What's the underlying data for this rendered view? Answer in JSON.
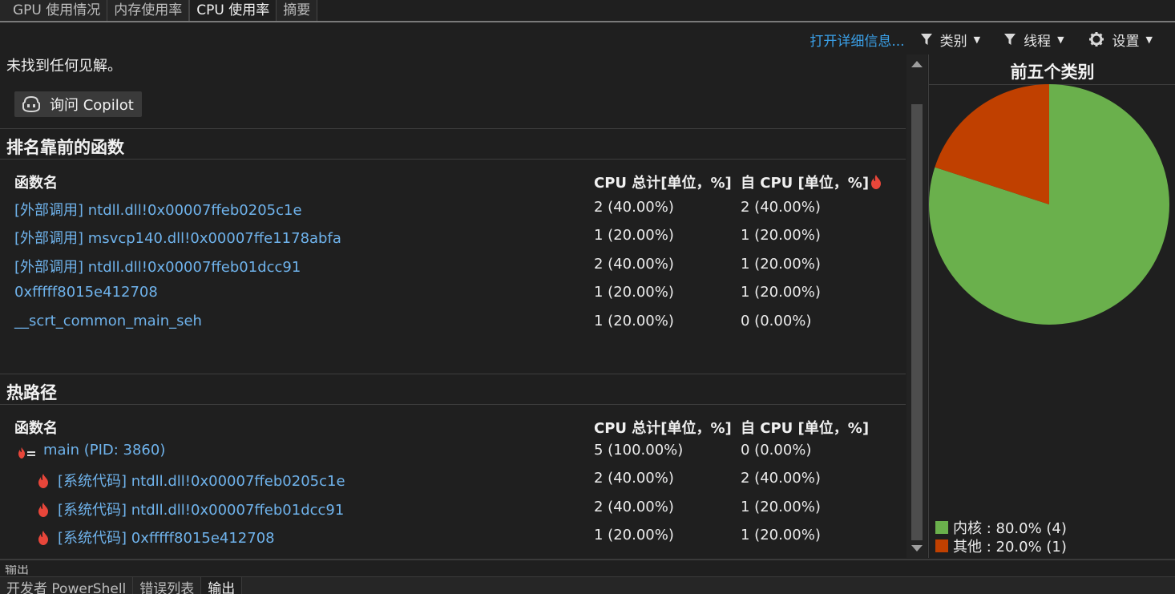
{
  "tabs": [
    "GPU 使用情况",
    "内存使用率",
    "CPU 使用率",
    "摘要"
  ],
  "active_tab": 2,
  "toolbar": {
    "open_details": "打开详细信息...",
    "category": "类别",
    "thread": "线程",
    "settings": "设置"
  },
  "insights": {
    "none_found": "未找到任何见解。",
    "ask_copilot": "询问 Copilot"
  },
  "top_functions": {
    "title": "排名靠前的函数",
    "columns": [
      "函数名",
      "CPU 总计[单位，%]",
      "自 CPU [单位，%]"
    ],
    "rows": [
      {
        "name": "[外部调用] ntdll.dll!0x00007ffeb0205c1e",
        "total": "2 (40.00%)",
        "self": "2 (40.00%)"
      },
      {
        "name": "[外部调用] msvcp140.dll!0x00007ffe1178abfa",
        "total": "1 (20.00%)",
        "self": "1 (20.00%)"
      },
      {
        "name": "[外部调用] ntdll.dll!0x00007ffeb01dcc91",
        "total": "2 (40.00%)",
        "self": "1 (20.00%)"
      },
      {
        "name": "0xfffff8015e412708",
        "total": "1 (20.00%)",
        "self": "1 (20.00%)"
      },
      {
        "name": "__scrt_common_main_seh",
        "total": "1 (20.00%)",
        "self": "0 (0.00%)"
      }
    ]
  },
  "hot_path": {
    "title": "热路径",
    "columns": [
      "函数名",
      "CPU 总计[单位，%]",
      "自 CPU [单位，%]"
    ],
    "rows": [
      {
        "name": "main (PID: 3860)",
        "total": "5 (100.00%)",
        "self": "0 (0.00%)"
      },
      {
        "name": "[系统代码] ntdll.dll!0x00007ffeb0205c1e",
        "total": "2 (40.00%)",
        "self": "2 (40.00%)"
      },
      {
        "name": "[系统代码] ntdll.dll!0x00007ffeb01dcc91",
        "total": "2 (40.00%)",
        "self": "1 (20.00%)"
      },
      {
        "name": "[系统代码] 0xfffff8015e412708",
        "total": "1 (20.00%)",
        "self": "1 (20.00%)"
      }
    ]
  },
  "chart_data": {
    "type": "pie",
    "title": "前五个类别",
    "slices": [
      {
        "label": "内核 : 80.0% (4)",
        "value": 80.0,
        "color": "#6ab04c"
      },
      {
        "label": "其他 : 20.0% (1)",
        "value": 20.0,
        "color": "#c04000"
      }
    ]
  },
  "bottom": {
    "output_strip_label": "输出",
    "tabs": [
      "开发者 PowerShell",
      "错误列表",
      "输出"
    ],
    "active_tab": 2
  },
  "colors": {
    "link": "#6fb3ec",
    "accent_link": "#3aa0e8",
    "flame": "#e8463a"
  }
}
